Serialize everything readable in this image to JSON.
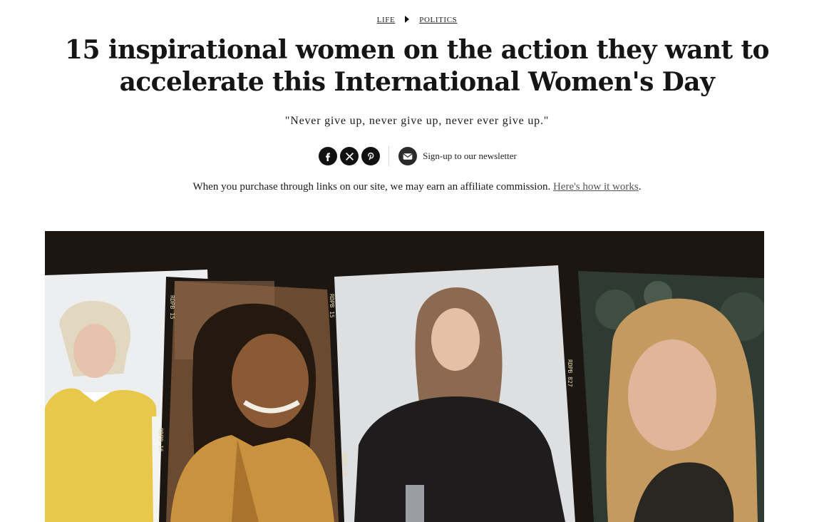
{
  "breadcrumb": {
    "items": [
      {
        "label": "LIFE"
      },
      {
        "label": "POLITICS"
      }
    ]
  },
  "article": {
    "title": "15 inspirational women on the action they want to accelerate this International Women's Day",
    "subtitle": "\"Never give up, never give up, never ever give up.\""
  },
  "share": {
    "icons": [
      "facebook-icon",
      "x-icon",
      "pinterest-icon",
      "mail-icon"
    ],
    "newsletter_label": "Sign-up to our newsletter"
  },
  "affiliate": {
    "text": "When you purchase through links on our site, we may earn an affiliate commission.",
    "link_label": "Here's how it works",
    "suffix": "."
  },
  "hero": {
    "film_labels": [
      "RDPB 15",
      "RDPB 15",
      "RDPB 16",
      "RDPB 16",
      "RDPB 827"
    ],
    "colors": {
      "film_border": "#1b1612",
      "sweater": "#e8c84a",
      "jacket": "#c9923e",
      "top_black": "#1e1c1c"
    }
  }
}
